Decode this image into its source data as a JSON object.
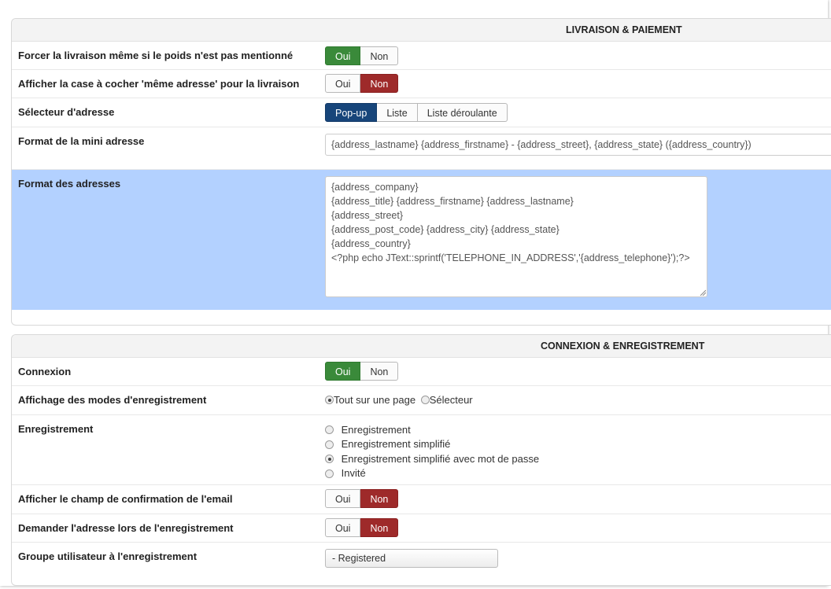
{
  "section_livraison": {
    "title": "LIVRAISON & PAIEMENT",
    "rows": {
      "force_shipping": {
        "label": "Forcer la livraison même si le poids n'est pas mentionné",
        "yes": "Oui",
        "no": "Non",
        "value": "Oui"
      },
      "same_address": {
        "label": "Afficher la case à cocher 'même adresse' pour la livraison",
        "yes": "Oui",
        "no": "Non",
        "value": "Non"
      },
      "address_selector": {
        "label": "Sélecteur d'adresse",
        "options": [
          "Pop-up",
          "Liste",
          "Liste déroulante"
        ],
        "value": "Pop-up"
      },
      "mini_address_format": {
        "label": "Format de la mini adresse",
        "value": "{address_lastname} {address_firstname} - {address_street}, {address_state} ({address_country})"
      },
      "address_format": {
        "label": "Format des adresses",
        "lines": [
          "{address_company}",
          "{address_title} {address_firstname} {address_lastname}",
          "{address_street}",
          "{address_post_code} {address_city} {address_state}",
          "{address_country}",
          "<?php echo JText::sprintf('TELEPHONE_IN_ADDRESS','{address_telephone}');?>"
        ]
      }
    }
  },
  "section_connexion": {
    "title": "CONNEXION & ENREGISTREMENT",
    "rows": {
      "login": {
        "label": "Connexion",
        "yes": "Oui",
        "no": "Non",
        "value": "Oui"
      },
      "registration_display": {
        "label": "Affichage des modes d'enregistrement",
        "options": [
          "Tout sur une page",
          "Sélecteur"
        ],
        "value": "Tout sur une page"
      },
      "registration": {
        "label": "Enregistrement",
        "options": [
          "Enregistrement",
          "Enregistrement simplifié",
          "Enregistrement simplifié avec mot de passe",
          "Invité"
        ],
        "value": "Enregistrement simplifié avec mot de passe"
      },
      "email_confirm": {
        "label": "Afficher le champ de confirmation de l'email",
        "yes": "Oui",
        "no": "Non",
        "value": "Non"
      },
      "ask_address": {
        "label": "Demander l'adresse lors de l'enregistrement",
        "yes": "Oui",
        "no": "Non",
        "value": "Non"
      },
      "user_group": {
        "label": "Groupe utilisateur à l'enregistrement",
        "value": "- Registered"
      }
    }
  },
  "colors": {
    "yes_active": "#3a8a3a",
    "no_active": "#9e2a2a",
    "selector_active": "#17457a",
    "highlight_row": "#b3d1ff"
  }
}
